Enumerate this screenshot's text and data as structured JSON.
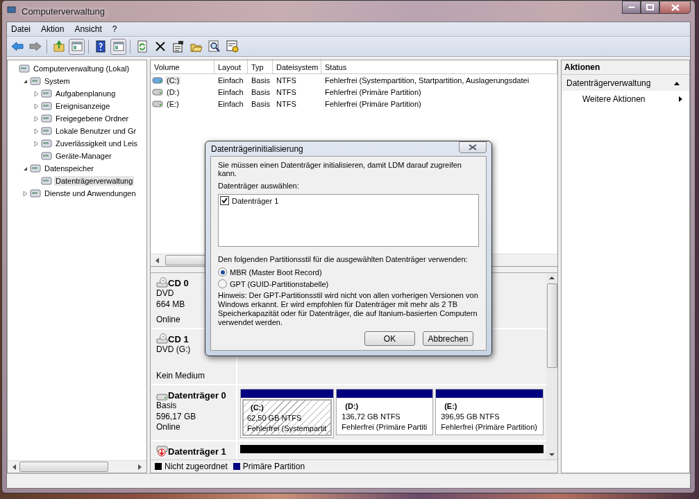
{
  "window": {
    "title": "Computerverwaltung"
  },
  "menu": [
    {
      "label": "Datei"
    },
    {
      "label": "Aktion"
    },
    {
      "label": "Ansicht"
    },
    {
      "label": "?"
    }
  ],
  "tree": [
    {
      "label": "Computerverwaltung (Lokal)",
      "selected": false,
      "children": [
        {
          "label": "System",
          "expanded": true,
          "selected": false,
          "children": [
            {
              "label": "Aufgabenplanung",
              "expanded": false,
              "selected": false
            },
            {
              "label": "Ereignisanzeige",
              "expanded": false,
              "selected": false
            },
            {
              "label": "Freigegebene Ordner",
              "expanded": false,
              "selected": false
            },
            {
              "label": "Lokale Benutzer und Gr",
              "expanded": false,
              "selected": false
            },
            {
              "label": "Zuverlässigkeit und Leis",
              "expanded": false,
              "selected": false
            },
            {
              "label": "Geräte-Manager",
              "selected": false
            }
          ]
        },
        {
          "label": "Datenspeicher",
          "expanded": true,
          "selected": false,
          "children": [
            {
              "label": "Datenträgerverwaltung",
              "selected": true
            }
          ]
        },
        {
          "label": "Dienste und Anwendungen",
          "expanded": false,
          "selected": false
        }
      ]
    }
  ],
  "volumes": {
    "columns": [
      "Volume",
      "Layout",
      "Typ",
      "Dateisystem",
      "Status"
    ],
    "rows": [
      {
        "selected": true,
        "cells": [
          "(C:)",
          "Einfach",
          "Basis",
          "NTFS",
          "Fehlerfrei (Systempartition, Startpartition, Auslagerungsdatei"
        ]
      },
      {
        "selected": false,
        "cells": [
          "(D:)",
          "Einfach",
          "Basis",
          "NTFS",
          "Fehlerfrei (Primäre Partition)"
        ]
      },
      {
        "selected": false,
        "cells": [
          "(E:)",
          "Einfach",
          "Basis",
          "NTFS",
          "Fehlerfrei (Primäre Partition)"
        ]
      }
    ]
  },
  "disks": [
    {
      "kind": "cdrom",
      "name": "CD 0",
      "lines": [
        "DVD",
        "664 MB",
        "Online"
      ]
    },
    {
      "kind": "cdrom",
      "name": "CD 1",
      "lines": [
        "DVD (G:)",
        "Kein Medium"
      ]
    },
    {
      "kind": "disk",
      "name": "Datenträger 0",
      "lines": [
        "Basis",
        "596,17 GB",
        "Online"
      ],
      "partitions": [
        {
          "label": "(C:)",
          "size": "62,50 GB NTFS",
          "status": "Fehlerfrei (Systempartit",
          "color": "#000080",
          "selected": true
        },
        {
          "label": "(D:)",
          "size": "136,72 GB NTFS",
          "status": "Fehlerfrei (Primäre Partiti",
          "color": "#000080",
          "selected": false
        },
        {
          "label": "(E:)",
          "size": "396,95 GB NTFS",
          "status": "Fehlerfrei (Primäre Partition)",
          "color": "#000080",
          "selected": false
        }
      ]
    },
    {
      "kind": "uninitialized",
      "name": "Datenträger 1",
      "partitions": [
        {
          "color": "#000000"
        }
      ]
    }
  ],
  "legend": [
    {
      "label": "Nicht zugeordnet",
      "color": "#000000"
    },
    {
      "label": "Primäre Partition",
      "color": "#000080"
    }
  ],
  "actions": {
    "title": "Aktionen",
    "section": {
      "label": "Datenträgerverwaltung",
      "expanded": true
    },
    "items": [
      {
        "label": "Weitere Aktionen"
      }
    ]
  },
  "dialog": {
    "title": "Datenträgerinitialisierung",
    "intro": "Sie müssen einen Datenträger initialisieren, damit LDM darauf zugreifen kann.",
    "list_label": "Datenträger auswählen:",
    "disks": [
      {
        "label": "Datenträger 1",
        "checked": true
      }
    ],
    "style_label": "Den folgenden Partitionsstil für die ausgewählten Datenträger verwenden:",
    "styles": [
      {
        "label": "MBR (Master Boot Record)",
        "selected": true
      },
      {
        "label": "GPT (GUID-Partitionstabelle)",
        "selected": false
      }
    ],
    "hint": "Hinweis: Der GPT-Partitionsstil wird nicht von allen vorherigen Versionen von Windows erkannt. Er wird empfohlen für Datenträger mit mehr als 2 TB Speicherkapazität oder für Datenträger, die auf Itanium-basierten Computern verwendet werden.",
    "buttons": [
      {
        "label": "OK"
      },
      {
        "label": "Abbrechen"
      }
    ]
  }
}
